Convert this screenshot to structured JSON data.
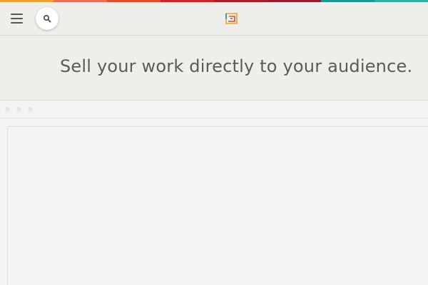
{
  "strip_colors": [
    "#f1a129",
    "#f26c57",
    "#e94a25",
    "#d81f26",
    "#b31629",
    "#9a1a2e",
    "#129c98",
    "#2bb1a8"
  ],
  "header": {
    "menu_icon": "hamburger-menu-icon",
    "search_icon": "search-icon",
    "logo_icon": "site-logo-icon"
  },
  "hero": {
    "headline": "Sell your work directly to your audience."
  }
}
